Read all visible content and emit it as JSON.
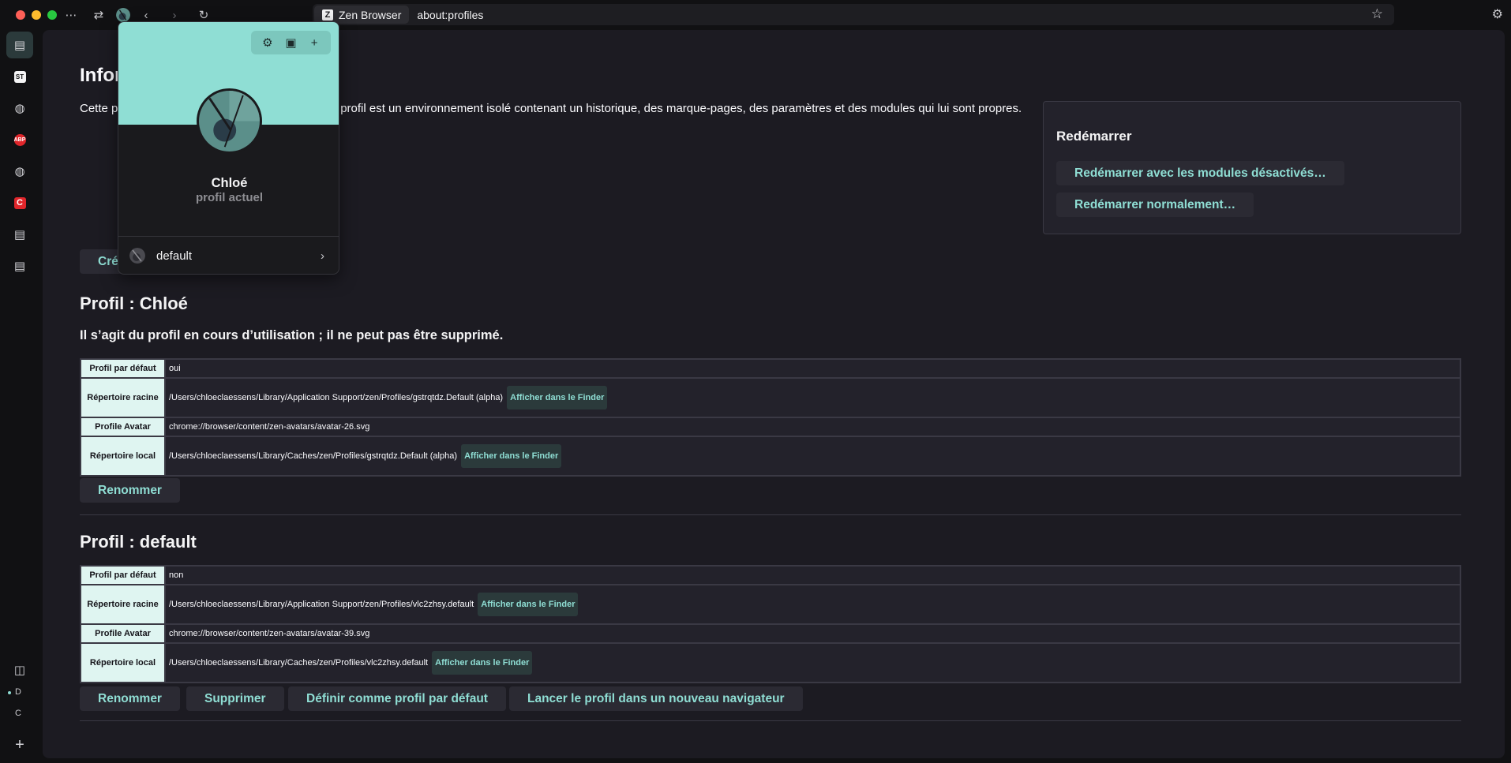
{
  "toolbar": {
    "identity_label": "Zen Browser",
    "url": "about:profiles"
  },
  "sidebar": {
    "workspaces": [
      "D",
      "C"
    ]
  },
  "page": {
    "title": "Informations sur les profils",
    "intro": "Cette page vous aide à gérer vos profils. Chaque profil est un environnement isolé contenant un historique, des marque-pages, des paramètres et des modules qui lui sont propres.",
    "create_button": "Créer un nouveau profil"
  },
  "restart": {
    "title": "Redémarrer",
    "with_addons_disabled": "Redémarrer avec les modules désactivés…",
    "normally": "Redémarrer normalement…"
  },
  "profiles": [
    {
      "heading": "Profil : Chloé",
      "note": "Il s’agit du profil en cours d’utilisation ; il ne peut pas être supprimé.",
      "rows": {
        "default_label": "Profil par défaut",
        "default_value": "oui",
        "root_label": "Répertoire racine",
        "root_value": "/Users/chloeclaessens/Library/Application Support/zen/Profiles/gstrqtdz.Default (alpha)",
        "avatar_label": "Profile Avatar",
        "avatar_value": "chrome://browser/content/zen-avatars/avatar-26.svg",
        "local_label": "Répertoire local",
        "local_value": "/Users/chloeclaessens/Library/Caches/zen/Profiles/gstrqtdz.Default (alpha)"
      },
      "finder_label": "Afficher dans le Finder",
      "rename": "Renommer"
    },
    {
      "heading": "Profil : default",
      "rows": {
        "default_label": "Profil par défaut",
        "default_value": "non",
        "root_label": "Répertoire racine",
        "root_value": "/Users/chloeclaessens/Library/Application Support/zen/Profiles/vlc2zhsy.default",
        "avatar_label": "Profile Avatar",
        "avatar_value": "chrome://browser/content/zen-avatars/avatar-39.svg",
        "local_label": "Répertoire local",
        "local_value": "/Users/chloeclaessens/Library/Caches/zen/Profiles/vlc2zhsy.default"
      },
      "finder_label": "Afficher dans le Finder",
      "rename": "Renommer",
      "delete": "Supprimer",
      "set_default": "Définir comme profil par défaut",
      "launch": "Lancer le profil dans un nouveau navigateur"
    }
  ],
  "popup": {
    "name": "Chloé",
    "subtitle": "profil actuel",
    "other_profile": "default"
  },
  "colors": {
    "accent": "#8fded4",
    "background": "#111113",
    "content": "#1c1b22",
    "label_cell": "#dff5f1"
  }
}
